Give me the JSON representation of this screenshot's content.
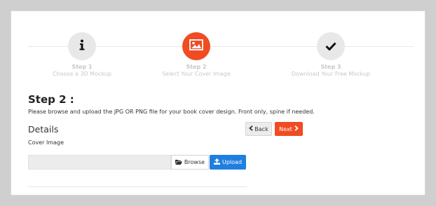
{
  "wizard": {
    "steps": [
      {
        "num": "Step 1",
        "desc": "Choose a 3D Mockup",
        "icon": "info-icon",
        "state": "inactive"
      },
      {
        "num": "Step 2",
        "desc": "Select Your Cover Image",
        "icon": "image-icon",
        "state": "active"
      },
      {
        "num": "Step 3",
        "desc": "Download Your Free Mockup",
        "icon": "check-icon",
        "state": "inactive"
      }
    ]
  },
  "content": {
    "heading": "Step 2 :",
    "instructions": "Please browse and upload the JPG OR PNG file for your book cover design. Front only, spine if needed.",
    "details_title": "Details",
    "back_label": "Back",
    "next_label": "Next",
    "cover_label": "Cover Image",
    "file_value": "",
    "browse_label": "Browse",
    "upload_label": "Upload"
  },
  "colors": {
    "accent": "#f04b23",
    "primary": "#1e7fe0",
    "inactive_circle": "#e8e8e8"
  }
}
